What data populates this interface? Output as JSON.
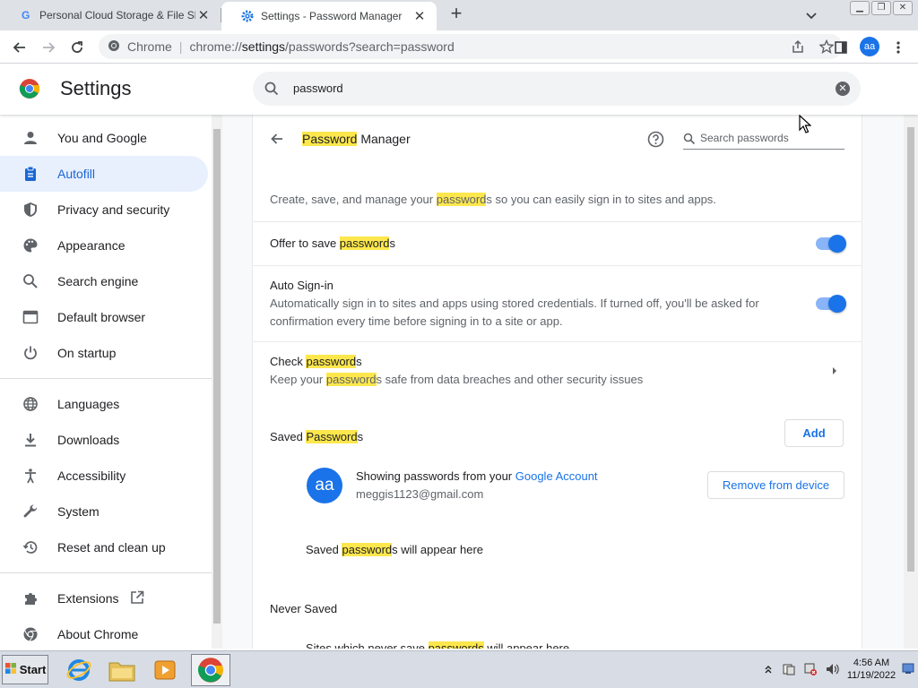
{
  "tabs": [
    {
      "title": "Personal Cloud Storage & File Sharing",
      "icon": "google-icon",
      "active": false
    },
    {
      "title": "Settings - Password Manager",
      "icon": "settings-gear-icon",
      "active": true
    }
  ],
  "omnibox": {
    "site_label": "Chrome",
    "url_scheme": "chrome://",
    "url_path": "settings",
    "url_rest": "/passwords?search=password"
  },
  "profile": {
    "initials": "aa"
  },
  "settings": {
    "title": "Settings",
    "search_value": "password"
  },
  "sidebar": {
    "items": [
      {
        "label": "You and Google",
        "icon": "person-icon"
      },
      {
        "label": "Autofill",
        "icon": "clipboard-icon",
        "selected": true
      },
      {
        "label": "Privacy and security",
        "icon": "shield-icon"
      },
      {
        "label": "Appearance",
        "icon": "palette-icon"
      },
      {
        "label": "Search engine",
        "icon": "search-icon"
      },
      {
        "label": "Default browser",
        "icon": "browser-icon"
      },
      {
        "label": "On startup",
        "icon": "power-icon"
      },
      {
        "label": "Languages",
        "icon": "globe-icon"
      },
      {
        "label": "Downloads",
        "icon": "download-icon"
      },
      {
        "label": "Accessibility",
        "icon": "accessibility-icon"
      },
      {
        "label": "System",
        "icon": "wrench-icon"
      },
      {
        "label": "Reset and clean up",
        "icon": "history-icon"
      },
      {
        "label": "Extensions",
        "icon": "puzzle-icon"
      },
      {
        "label": "About Chrome",
        "icon": "chrome-icon"
      }
    ]
  },
  "pm": {
    "title_hl": "Password",
    "title_rest": " Manager",
    "search_placeholder": "Search passwords",
    "desc_pre": "Create, save, and manage your ",
    "desc_hl": "password",
    "desc_post": "s so you can easily sign in to sites and apps.",
    "offer_pre": "Offer to save ",
    "offer_hl": "password",
    "offer_post": "s",
    "offer_enabled": true,
    "autosignin_title": "Auto Sign-in",
    "autosignin_desc1": "Automatically sign in to sites and apps using stored credentials. If turned off, you'll be asked for",
    "autosignin_desc2": "confirmation every time before signing in to a site or app.",
    "autosignin_enabled": true,
    "check_pre": "Check ",
    "check_hl": "password",
    "check_post": "s",
    "check_desc_pre": "Keep your ",
    "check_desc_hl": "password",
    "check_desc_post": "s safe from data breaches and other security issues",
    "saved_pre": "Saved ",
    "saved_hl": "Password",
    "saved_post": "s",
    "add_label": "Add",
    "account_initials": "aa",
    "account_text": "Showing passwords from your ",
    "account_link": "Google Account",
    "account_email": "meggis1123@gmail.com",
    "remove_label": "Remove from device",
    "empty_pre": "Saved ",
    "empty_hl": "password",
    "empty_post": "s will appear here",
    "never_saved": "Never Saved",
    "never_pre": "Sites which never save ",
    "never_hl": "passwords",
    "never_post": " will appear here"
  },
  "taskbar": {
    "start_label": "Start",
    "time": "4:56 AM",
    "date": "11/19/2022"
  },
  "colors": {
    "accent": "#1a73e8",
    "highlight": "#fde74c",
    "selected_bg": "#e8f0fe"
  }
}
